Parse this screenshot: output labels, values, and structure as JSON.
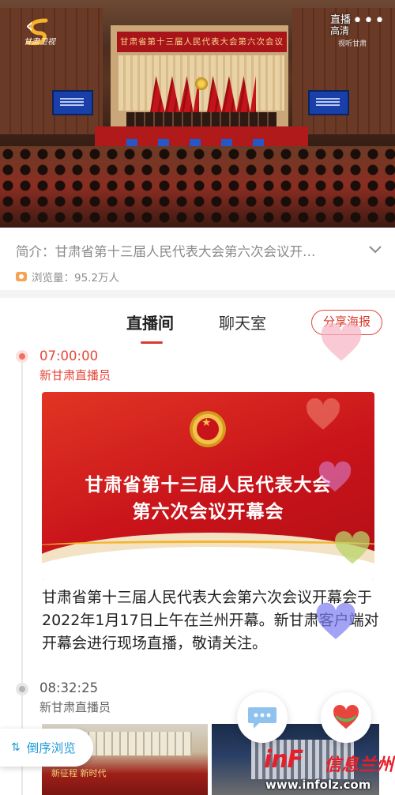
{
  "video": {
    "channel_logo_text": "甘肃卫视",
    "stage_banner": "甘肃省第十三届人民代表大会第六次会议",
    "live_label": "直播",
    "quality_label": "高清",
    "network_label": "视听甘肃"
  },
  "info": {
    "intro": "简介：甘肃省第十三届人民代表大会第六次会议开…",
    "views": "浏览量：95.2万人"
  },
  "tabs": {
    "live_room": "直播间",
    "chat_room": "聊天室",
    "share_poster": "分享海报"
  },
  "posts": [
    {
      "time": "07:00:00",
      "author": "新甘肃直播员",
      "poster_line1": "甘肃省第十三届人民代表大会",
      "poster_line2": "第六次会议开幕会",
      "text": "甘肃省第十三届人民代表大会第六次会议开幕会于2022年1月17日上午在兰州开幕。新甘肃客户端对开幕会进行现场直播，敬请关注。"
    },
    {
      "time": "08:32:25",
      "author": "新甘肃直播员",
      "thumb_text": "新征程 新时代"
    }
  ],
  "controls": {
    "reverse_browse": "倒序浏览",
    "reverse_icon": "sort-arrows-icon",
    "comment_icon": "comment-icon",
    "like_icon": "heart-like-icon"
  },
  "watermark": {
    "brand": "inF",
    "chinese": "信息兰州",
    "url": "www.infolz.com"
  },
  "colors": {
    "accent_red": "#e5473a",
    "poster_red": "#c8131a",
    "link_blue": "#1e9ad6"
  }
}
